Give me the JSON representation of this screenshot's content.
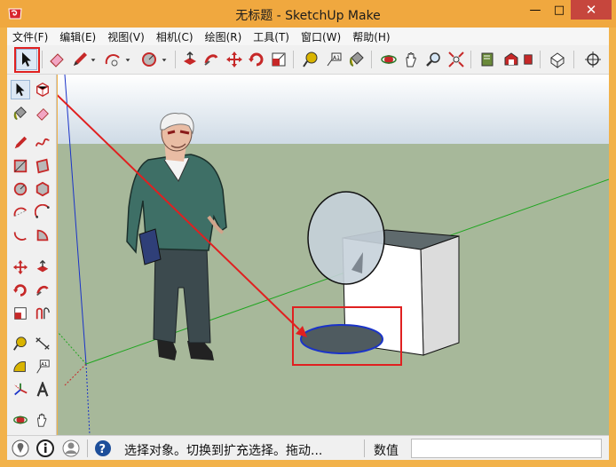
{
  "window": {
    "title": "无标题 - SketchUp Make",
    "minimize": "—",
    "maximize": "□",
    "close": "✕"
  },
  "menu": [
    "文件(F)",
    "编辑(E)",
    "视图(V)",
    "相机(C)",
    "绘图(R)",
    "工具(T)",
    "窗口(W)",
    "帮助(H)"
  ],
  "toolbar_icons": [
    "select-icon",
    "eraser-icon",
    "pencil-icon",
    "arc-icon",
    "circle-icon",
    "push-pull-icon",
    "follow-me-icon",
    "move-icon",
    "rotate-icon",
    "scale-icon",
    "tape-measure-icon",
    "text-icon",
    "paint-bucket-icon",
    "orbit-icon",
    "pan-icon",
    "zoom-icon",
    "zoom-extents-icon",
    "component-icon",
    "warehouse-icon",
    "extension-icon",
    "model-info-icon",
    "position-camera-icon"
  ],
  "left_toolbar_icons": [
    "select-icon",
    "make-component-icon",
    "paint-bucket-icon",
    "eraser-icon",
    "line-icon",
    "freehand-icon",
    "rectangle-icon",
    "rotated-rectangle-icon",
    "circle-icon",
    "polygon-icon",
    "arc-icon",
    "two-point-arc-icon",
    "three-point-arc-icon",
    "pie-icon",
    "move-icon",
    "push-pull-icon",
    "rotate-icon",
    "follow-me-icon",
    "scale-icon",
    "offset-icon",
    "tape-measure-icon",
    "dimension-icon",
    "protractor-icon",
    "text-label-icon",
    "axes-icon",
    "3d-text-icon",
    "orbit-icon",
    "pan-icon"
  ],
  "status": {
    "message": "选择对象。切换到扩充选择。拖动...",
    "measurements_label": "数值",
    "measurements_value": ""
  },
  "colors": {
    "title_bar": "#f0a83f",
    "close_button": "#c6463d",
    "sky": "#d8e3ec",
    "ground": "#a7b89a",
    "annotation_red": "#e02020",
    "selection_blue": "#1a33c8"
  }
}
